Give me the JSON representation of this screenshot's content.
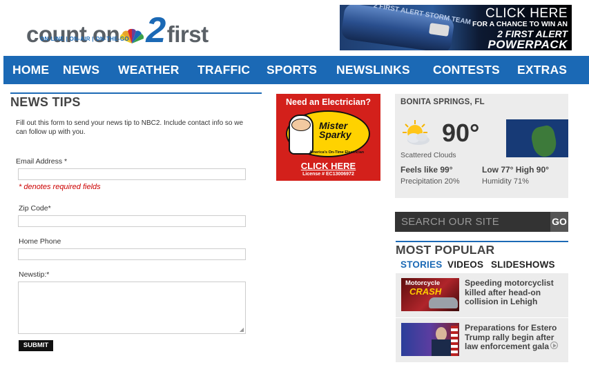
{
  "header": {
    "logo": {
      "part1": "count on",
      "number": "2",
      "part2": "first",
      "tagline": "ON-LINE | ON-AIR | ON-THE-GO"
    },
    "banner_ad": {
      "cylinder_text": "2 FIRST ALERT STORM TEAM",
      "line1": "CLICK HERE",
      "line2": "FOR A CHANCE TO WIN AN",
      "line3": "2 FIRST ALERT",
      "line4": "POWERPACK"
    }
  },
  "nav": {
    "items": [
      "HOME",
      "NEWS",
      "WEATHER",
      "TRAFFIC",
      "SPORTS",
      "NEWSLINKS",
      "CONTESTS",
      "EXTRAS"
    ]
  },
  "news_tips": {
    "title": "NEWS TIPS",
    "intro": "Fill out this form to send your news tip to NBC2. Include contact info so we can follow up with you.",
    "email_label": "Email Address *",
    "email_value": "",
    "required_note": "* denotes required fields",
    "zip_label": "Zip Code*",
    "zip_value": "",
    "phone_label": "Home Phone",
    "phone_value": "",
    "newstip_label": "Newstip:*",
    "newstip_value": "",
    "submit_label": "SUBMIT"
  },
  "electrician_ad": {
    "headline": "Need an Electrician?",
    "brand": "Mister Sparky",
    "tagline": "America's On-Time Electrician",
    "cta": "CLICK HERE",
    "license": "License # EC13006972"
  },
  "weather": {
    "location": "BONITA SPRINGS, FL",
    "temperature": "90°",
    "condition": "Scattered Clouds",
    "feels_like": "Feels like 99°",
    "hi_lo": "Low 77° High 90°",
    "precipitation": "Precipitation 20%",
    "humidity": "Humidity 71%",
    "icon": "partly-cloudy-icon"
  },
  "search": {
    "placeholder": "SEARCH OUR SITE",
    "go_label": "GO"
  },
  "most_popular": {
    "title": "MOST POPULAR",
    "tabs": [
      "STORIES",
      "VIDEOS",
      "SLIDESHOWS"
    ],
    "active_tab": "STORIES",
    "stories": [
      {
        "title": "Speeding motorcyclist killed after head-on collision in Lehigh",
        "thumb_text1": "Motorcycle",
        "thumb_text2": "CRASH"
      },
      {
        "title": "Preparations for Estero Trump rally begin after law enforcement gala"
      }
    ]
  },
  "colors": {
    "brand_blue": "#1b69b5",
    "required_red": "#cc0000",
    "ad_red": "#d3201b"
  }
}
